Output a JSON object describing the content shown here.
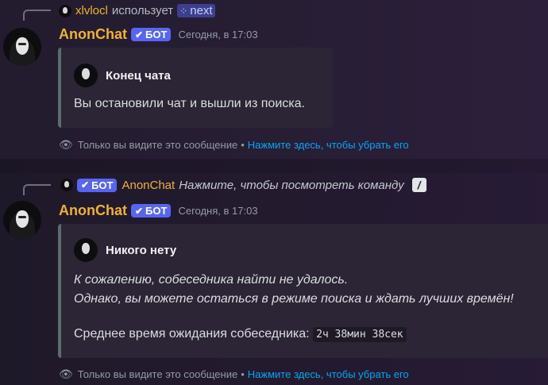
{
  "messages": [
    {
      "reply": {
        "user": "xlvlocl",
        "action": "использует",
        "command_icon": "⁘",
        "command": "next"
      },
      "author": "AnonChat",
      "badge": "БОТ",
      "timestamp": "Сегодня, в 17:03",
      "embed": {
        "title": "Конец чата",
        "text": "Вы остановили чат и вышли из поиска."
      },
      "ephemeral": {
        "text": "Только вы видите это сообщение",
        "dismiss": "Нажмите здесь, чтобы убрать его"
      }
    },
    {
      "reply": {
        "badge": "БОТ",
        "user": "AnonChat",
        "hint": "Нажмите, чтобы посмотреть команду",
        "slash_icon": "/"
      },
      "author": "AnonChat",
      "badge": "БОТ",
      "timestamp": "Сегодня, в 17:03",
      "embed": {
        "title": "Никого нету",
        "line1": "К сожалению, собеседника найти не удалось.",
        "line2": "Однако, вы можете остаться в режиме поиска и ждать лучших времён!",
        "wait_label": "Среднее время ожидания собеседника:",
        "wait_value": "2ч 38мин 38сек"
      },
      "ephemeral": {
        "text": "Только вы видите это сообщение",
        "dismiss": "Нажмите здесь, чтобы убрать его"
      }
    }
  ],
  "colors": {
    "username": "#f0b232",
    "bot_badge": "#5865f2",
    "link": "#00a8fc",
    "embed_border": "#5d6b6e"
  }
}
